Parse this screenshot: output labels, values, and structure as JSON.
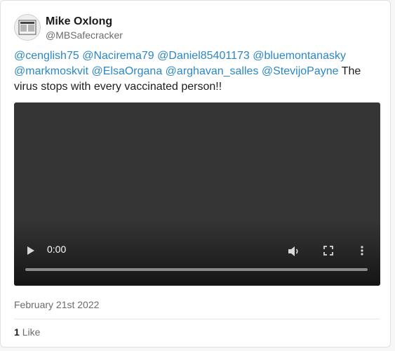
{
  "author": {
    "display_name": "Mike Oxlong",
    "handle": "@MBSafecracker"
  },
  "tweet": {
    "mentions": [
      "@cenglish75",
      "@Nacirema79",
      "@Daniel85401173",
      "@bluemontanasky",
      "@markmoskvit",
      "@ElsaOrgana",
      "@arghavan_salles",
      "@StevijoPayne"
    ],
    "text": "The virus stops with every vaccinated person!!"
  },
  "video": {
    "current_time": "0:00",
    "progress_fraction": 0,
    "icons": [
      "play-icon",
      "volume-icon",
      "fullscreen-icon",
      "more-options-icon"
    ]
  },
  "date": "February 21st 2022",
  "likes": {
    "count": "1",
    "label": "Like"
  },
  "colors": {
    "mention": "#2b87c7",
    "video_bg": "#353535",
    "muted_text": "#6b6b6b"
  }
}
